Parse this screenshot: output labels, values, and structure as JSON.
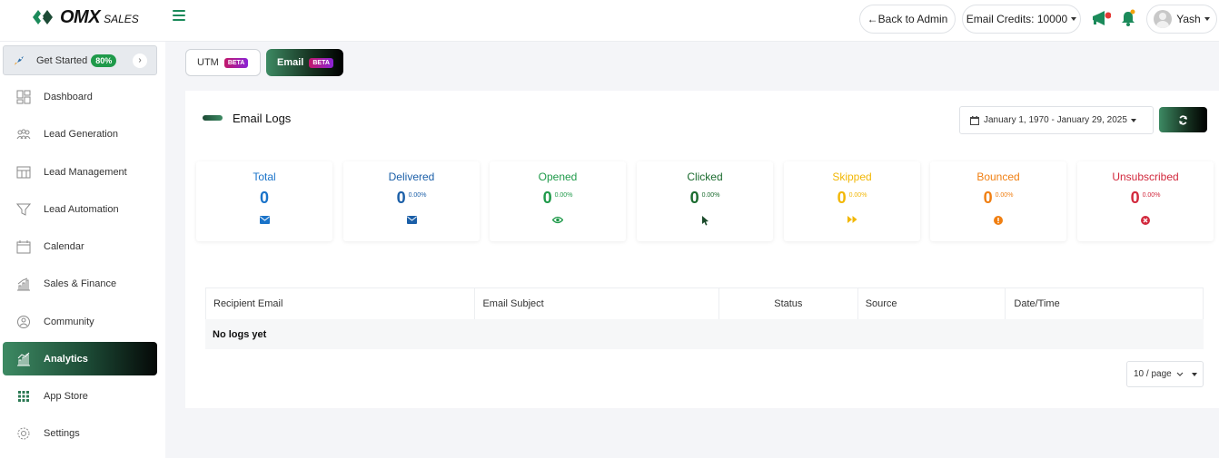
{
  "brand": {
    "name": "OMX",
    "sub": "SALES"
  },
  "header": {
    "back_label": "←Back to Admin",
    "credits_label": "Email Credits: 10000",
    "user_name": "Yash",
    "notification_color": "#e53935"
  },
  "sidebar": {
    "get_started": {
      "label": "Get Started",
      "badge": "80%"
    },
    "items": [
      {
        "label": "Dashboard",
        "icon": "dashboard-icon"
      },
      {
        "label": "Lead Generation",
        "icon": "users-icon"
      },
      {
        "label": "Lead Management",
        "icon": "table-icon"
      },
      {
        "label": "Lead Automation",
        "icon": "funnel-icon"
      },
      {
        "label": "Calendar",
        "icon": "calendar-icon"
      },
      {
        "label": "Sales & Finance",
        "icon": "chart-icon"
      },
      {
        "label": "Community",
        "icon": "community-icon"
      },
      {
        "label": "Analytics",
        "icon": "analytics-icon",
        "active": true
      },
      {
        "label": "App Store",
        "icon": "grid-icon"
      },
      {
        "label": "Settings",
        "icon": "gear-icon"
      }
    ]
  },
  "tabs": [
    {
      "label": "UTM",
      "badge": "BETA"
    },
    {
      "label": "Email",
      "badge": "BETA",
      "active": true
    }
  ],
  "logs": {
    "title": "Email Logs",
    "date_range": "January 1, 1970 - January 29, 2025",
    "stats": [
      {
        "label": "Total",
        "value": "0",
        "pct": "",
        "color": "#1a73c9",
        "icon": "envelope-icon"
      },
      {
        "label": "Delivered",
        "value": "0",
        "pct": "0.00%",
        "color": "#1b5fa8",
        "icon": "envelope-icon"
      },
      {
        "label": "Opened",
        "value": "0",
        "pct": "0.00%",
        "color": "#1f9a4a",
        "icon": "eye-icon"
      },
      {
        "label": "Clicked",
        "value": "0",
        "pct": "0.00%",
        "color": "#1a6b2e",
        "icon": "cursor-icon"
      },
      {
        "label": "Skipped",
        "value": "0",
        "pct": "0.00%",
        "color": "#f2b705",
        "icon": "fast-forward-icon"
      },
      {
        "label": "Bounced",
        "value": "0",
        "pct": "0.00%",
        "color": "#f07f12",
        "icon": "alert-icon"
      },
      {
        "label": "Unsubscribed",
        "value": "0",
        "pct": "0.00%",
        "color": "#d2293d",
        "icon": "close-circle-icon"
      }
    ],
    "columns": [
      "Recipient Email",
      "Email Subject",
      "Status",
      "Source",
      "Date/Time"
    ],
    "empty_text": "No logs yet",
    "page_size": "10 / page"
  }
}
